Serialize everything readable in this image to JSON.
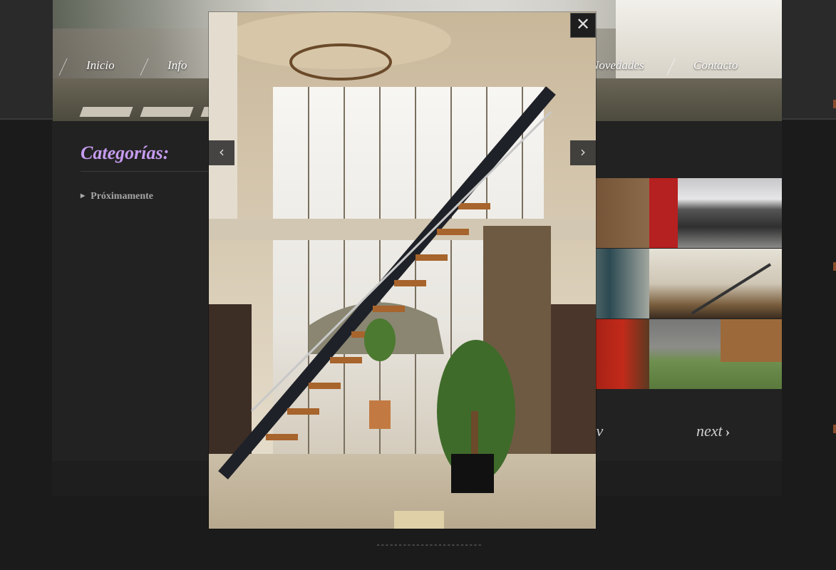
{
  "nav": {
    "items": [
      "Inicio",
      "Info",
      "Novedades",
      "Contacto"
    ]
  },
  "sidebar": {
    "title": "Categorías:",
    "items": [
      "Próximamente"
    ]
  },
  "gallery": {
    "prev_label": "prev",
    "next_label": "next",
    "next_arrow": "›"
  },
  "footer": {
    "dashes": "------------------------"
  },
  "lightbox": {
    "close_icon": "✕",
    "prev_icon": "‹",
    "next_icon": "›"
  },
  "colors": {
    "category_title": "#c69cf0",
    "background": "#1b1b1b",
    "panel": "#222222"
  },
  "icons": {
    "close": "close-icon",
    "prev": "chevron-left-icon",
    "next": "chevron-right-icon",
    "bullet": "triangle-right-icon"
  }
}
